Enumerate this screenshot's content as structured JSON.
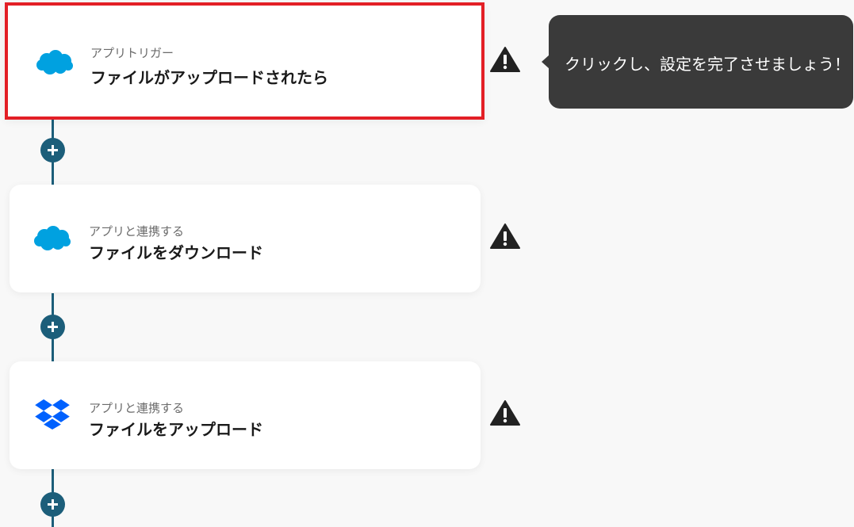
{
  "flow": {
    "steps": [
      {
        "type_label": "アプリトリガー",
        "title": "ファイルがアップロードされたら",
        "app_icon": "salesforce-cloud-icon",
        "warning_icon": "warning-triangle-icon"
      },
      {
        "type_label": "アプリと連携する",
        "title": "ファイルをダウンロード",
        "app_icon": "salesforce-cloud-icon",
        "warning_icon": "warning-triangle-icon"
      },
      {
        "type_label": "アプリと連携する",
        "title": "ファイルをアップロード",
        "app_icon": "dropbox-icon",
        "warning_icon": "warning-triangle-icon"
      }
    ],
    "add_step_icon": "plus-icon"
  },
  "tooltip": {
    "text": "クリックし、設定を完了させましょう！"
  },
  "colors": {
    "flow_line": "#1c5e7a",
    "highlight_border": "#e31f26",
    "tooltip_bg": "#3a3a3a",
    "salesforce": "#00a1e0",
    "dropbox": "#0061fe"
  }
}
